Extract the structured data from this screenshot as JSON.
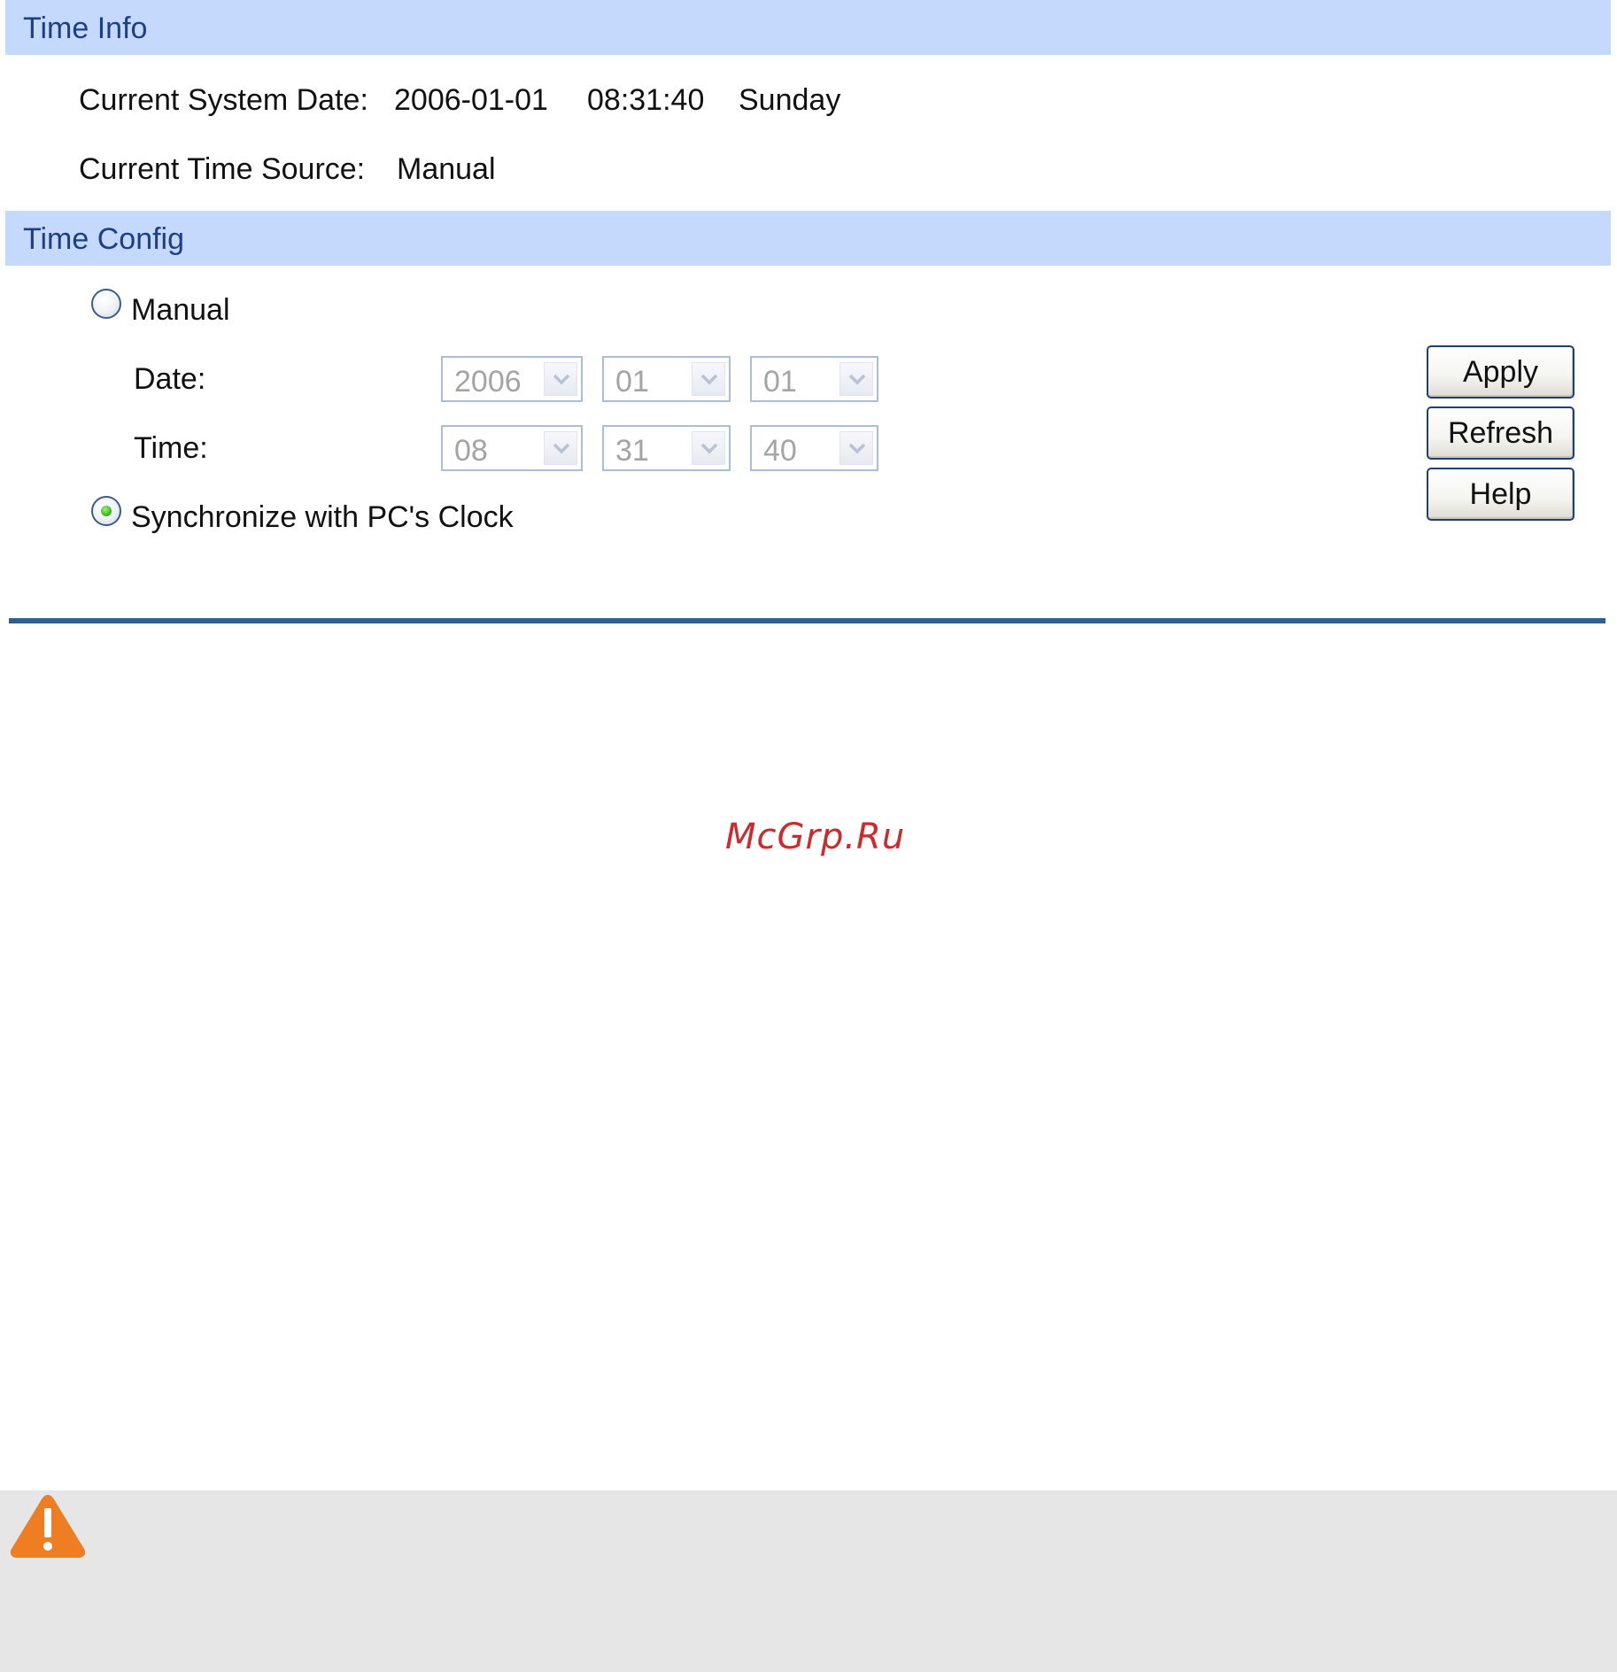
{
  "time_info": {
    "header": "Time Info",
    "system_date_label": "Current System Date:",
    "system_date": "2006-01-01",
    "system_time": "08:31:40",
    "system_day": "Sunday",
    "time_source_label": "Current Time Source:",
    "time_source": "Manual"
  },
  "time_config": {
    "header": "Time Config",
    "manual_label": "Manual",
    "manual_selected": false,
    "date_label": "Date:",
    "date_year": "2006",
    "date_month": "01",
    "date_day": "01",
    "time_label": "Time:",
    "time_hour": "08",
    "time_minute": "31",
    "time_second": "40",
    "sync_label": "Synchronize with PC's Clock",
    "sync_selected": true
  },
  "buttons": {
    "apply": "Apply",
    "refresh": "Refresh",
    "help": "Help"
  },
  "watermark": "McGrp.Ru",
  "icons": {
    "warning": "warning-icon",
    "dropdown": "chevron-down-icon"
  },
  "colors": {
    "section_header_bg": "#c5d9fc",
    "section_header_text": "#1e3f86",
    "rule": "#2f6190",
    "watermark": "#cc2a2e",
    "warning": "#ef7d22",
    "note_bg": "#e6e6e6"
  }
}
